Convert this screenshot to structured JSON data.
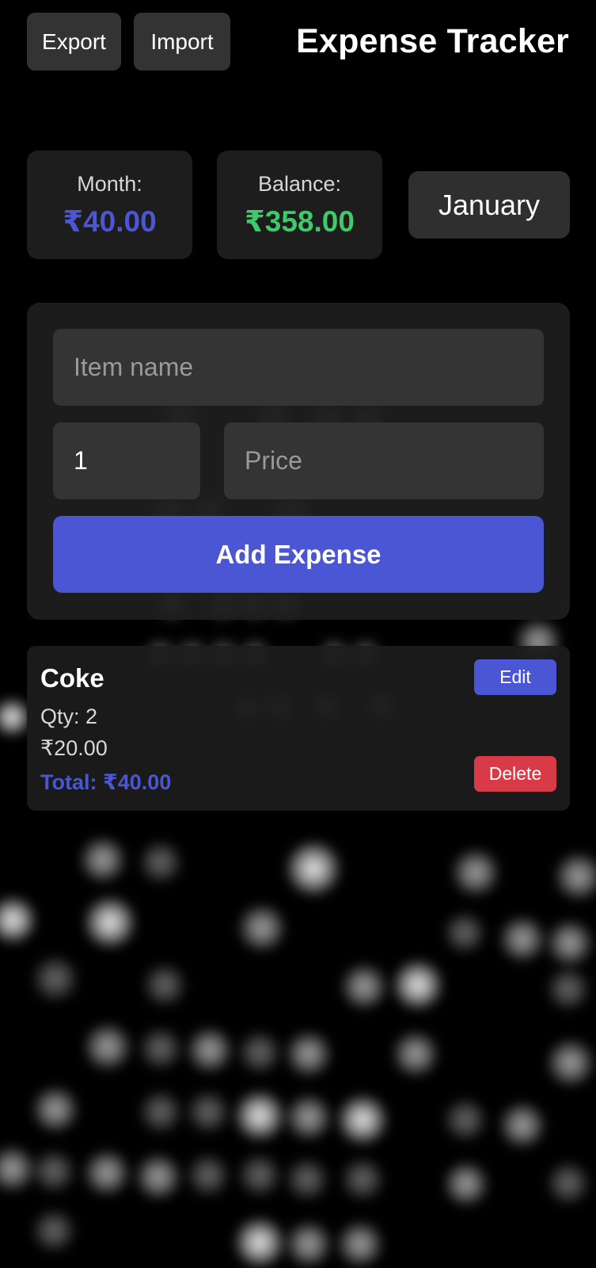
{
  "header": {
    "export_label": "Export",
    "import_label": "Import",
    "title": "Expense Tracker"
  },
  "summary": {
    "month_label": "Month:",
    "month_value": "₹40.00",
    "balance_label": "Balance:",
    "balance_value": "₹358.00",
    "selected_month": "January"
  },
  "form": {
    "item_name_placeholder": "Item name",
    "quantity_value": "1",
    "price_placeholder": "Price",
    "add_button_label": "Add Expense"
  },
  "expenses": [
    {
      "name": "Coke",
      "qty": "Qty: 2",
      "price": "₹20.00",
      "total": "Total: ₹40.00",
      "edit_label": "Edit",
      "delete_label": "Delete"
    }
  ],
  "colors": {
    "accent": "#4a56d4",
    "balance_green": "#3fc96a",
    "danger": "#d93a48"
  }
}
